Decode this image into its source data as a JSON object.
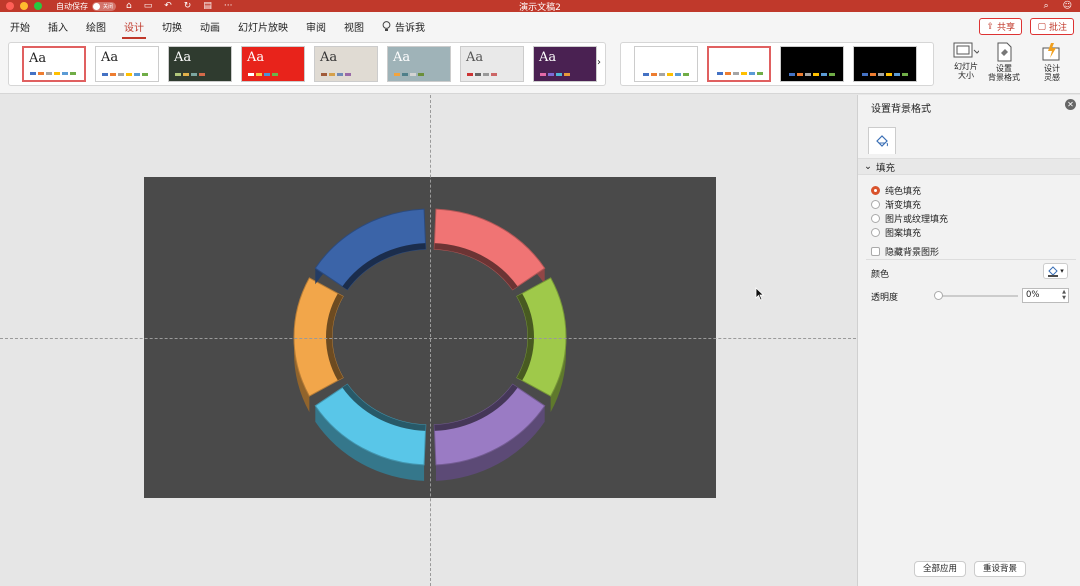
{
  "window": {
    "autosave_label": "自动保存",
    "autosave_toggle": "关闭",
    "title": "演示文稿2"
  },
  "menu": {
    "tabs": [
      "开始",
      "插入",
      "绘图",
      "设计",
      "切换",
      "动画",
      "幻灯片放映",
      "审阅",
      "视图"
    ],
    "active_tab": "设计",
    "tell_me": "告诉我",
    "share": "共享",
    "comment": "批注"
  },
  "ribbon": {
    "themes": [
      {
        "label": "Aa",
        "bg": "#ffffff",
        "fg": "#222222",
        "selected": true
      },
      {
        "label": "Aa",
        "bg": "#ffffff",
        "fg": "#222222",
        "selected": false
      },
      {
        "label": "Aa",
        "bg": "#2f3b2f",
        "fg": "#ffffff",
        "selected": false
      },
      {
        "label": "Aa",
        "bg": "#e8231b",
        "fg": "#ffffff",
        "selected": false
      },
      {
        "label": "Aa",
        "bg": "#e0dbd3",
        "fg": "#333333",
        "selected": false
      },
      {
        "label": "Aa",
        "bg": "#9fb3b8",
        "fg": "#ffffff",
        "selected": false
      },
      {
        "label": "Aa",
        "bg": "#e9e9e9",
        "fg": "#555555",
        "selected": false
      },
      {
        "label": "Aa",
        "bg": "#4a2152",
        "fg": "#ffffff",
        "selected": false
      }
    ],
    "variants": [
      {
        "bg": "#ffffff",
        "selected": false
      },
      {
        "bg": "#ffffff",
        "selected": true
      },
      {
        "bg": "#000000",
        "selected": false
      },
      {
        "bg": "#000000",
        "selected": false
      }
    ],
    "slide_size_label": "幻灯片大小",
    "format_bg_label": "设置背景格式",
    "designer_label": "设计灵感",
    "slide_size_lines": [
      "幻灯片",
      "大小"
    ],
    "format_bg_lines": [
      "设置",
      "背景格式"
    ],
    "designer_lines": [
      "设计",
      "灵感"
    ]
  },
  "slide": {
    "background": "#4a4a4a",
    "ring_segments": [
      {
        "color": "#f07474"
      },
      {
        "color": "#9fc94a"
      },
      {
        "color": "#9a7bc4"
      },
      {
        "color": "#59c6e8"
      },
      {
        "color": "#f2a64a"
      },
      {
        "color": "#3b64a8"
      }
    ]
  },
  "pane": {
    "title": "设置背景格式",
    "section": "填充",
    "fill_options": [
      {
        "label": "纯色填充",
        "checked": true
      },
      {
        "label": "渐变填充",
        "checked": false
      },
      {
        "label": "图片或纹理填充",
        "checked": false
      },
      {
        "label": "图案填充",
        "checked": false
      }
    ],
    "hide_bg_graphics": "隐藏背景图形",
    "color_label": "颜色",
    "transparency_label": "透明度",
    "transparency_value": "0%",
    "transparency": 0,
    "apply_all": "全部应用",
    "reset_bg": "重设背景"
  }
}
